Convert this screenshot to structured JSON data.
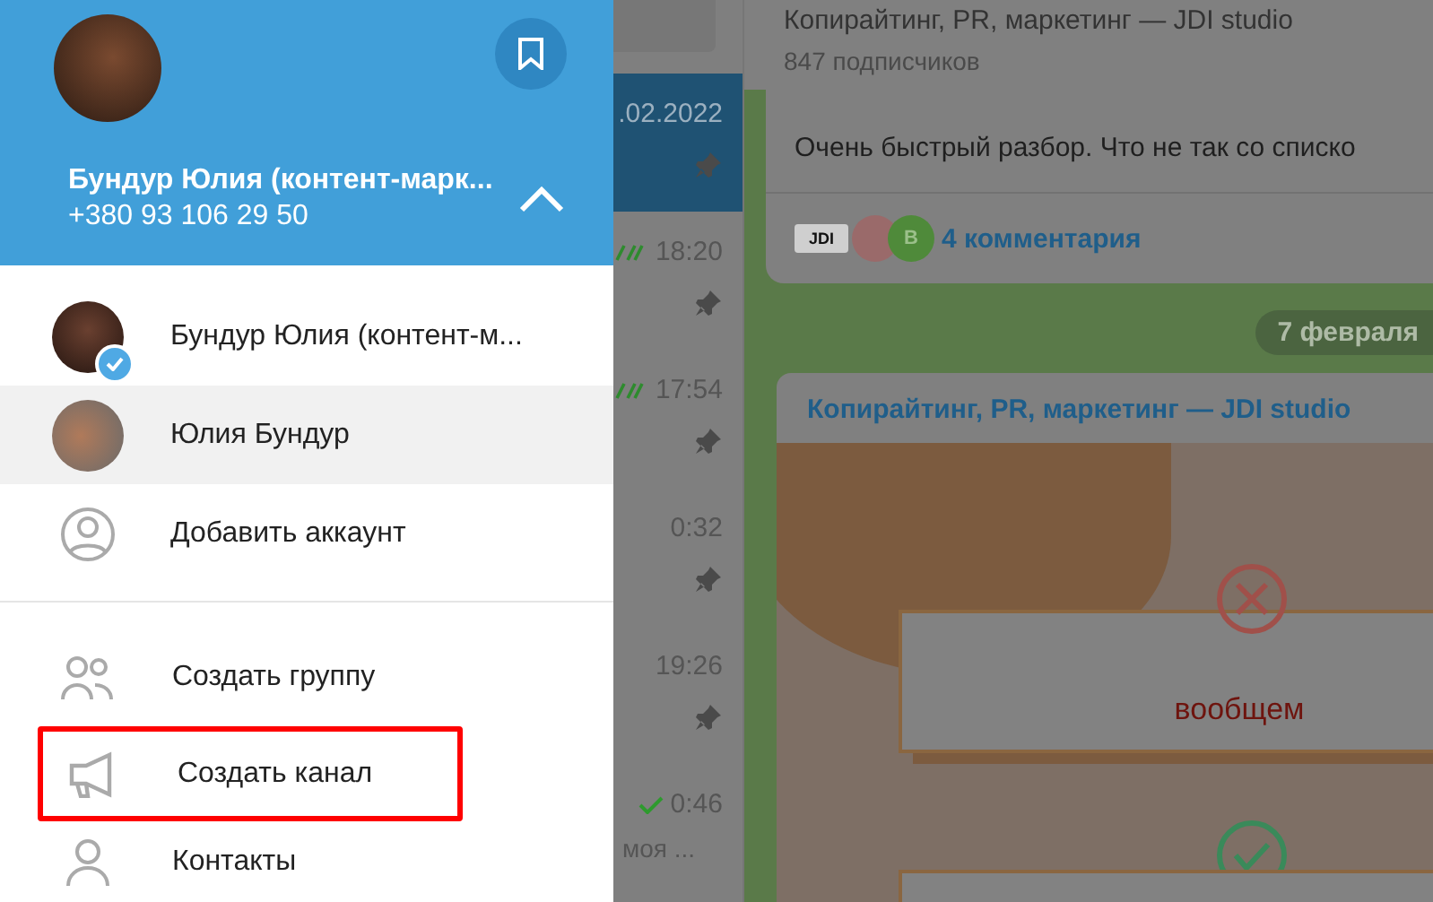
{
  "drawer": {
    "profile": {
      "name": "Бундур Юлия (контент-марк...",
      "phone": "+380 93 106 29 50",
      "accounts_expanded": true
    },
    "accounts": [
      {
        "name": "Бундур Юлия (контент-м...",
        "selected": true,
        "hovered": false
      },
      {
        "name": "Юлия Бундур",
        "selected": false,
        "hovered": true
      }
    ],
    "add_account": "Добавить аккаунт",
    "menu": [
      {
        "kind": "group",
        "label": "Создать группу",
        "outlined": false
      },
      {
        "kind": "channel",
        "label": "Создать канал",
        "outlined": true
      },
      {
        "kind": "contact",
        "label": "Контакты",
        "outlined": false
      }
    ]
  },
  "chat_list": {
    "rows": [
      {
        "time": ".02.2022",
        "selected": true,
        "pinned": true,
        "delivered": false
      },
      {
        "time": "18:20",
        "selected": false,
        "pinned": true,
        "delivered": true,
        "read": true
      },
      {
        "time": "17:54",
        "selected": false,
        "pinned": true,
        "delivered": true,
        "read": true
      },
      {
        "time": "0:32",
        "selected": false,
        "pinned": true,
        "delivered": false
      },
      {
        "time": "19:26",
        "selected": false,
        "pinned": true,
        "delivered": false
      },
      {
        "time": "0:46",
        "selected": false,
        "pinned": false,
        "delivered": true,
        "read": false,
        "preview": "моя ..."
      }
    ]
  },
  "chat": {
    "title": "Копирайтинг, PR, маркетинг — JDI studio",
    "subtitle": "847 подписчиков",
    "post": {
      "text": "Очень быстрый разбор. Что не так со списко",
      "commenters": [
        {
          "kind": "logo",
          "label": "JDI"
        },
        {
          "kind": "photo"
        },
        {
          "kind": "letter",
          "label": "В"
        }
      ],
      "comments": "4 комментария"
    },
    "date": "7 февраля",
    "post2": {
      "sender": "Копирайтинг, PR, маркетинг — JDI studio",
      "card_text": "вообщем"
    }
  }
}
